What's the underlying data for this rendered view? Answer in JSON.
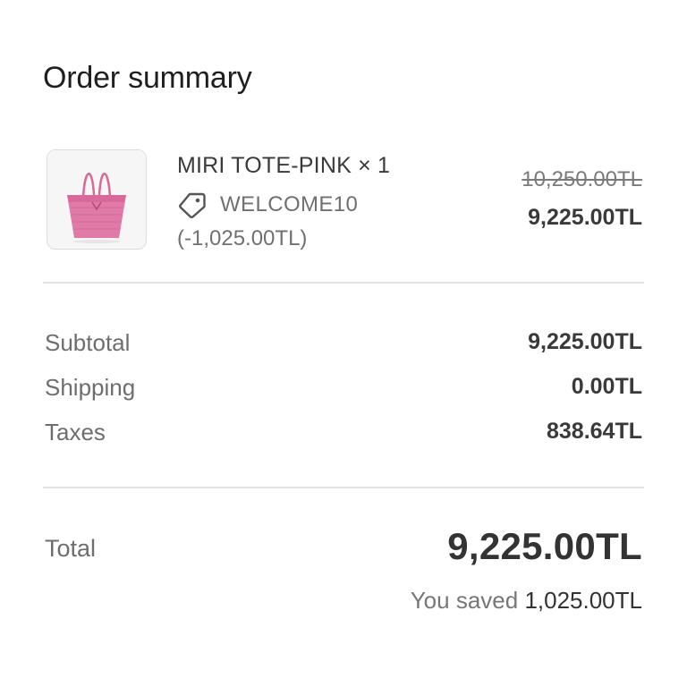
{
  "summary": {
    "title": "Order summary"
  },
  "product": {
    "image_icon": "pink-tote-bag",
    "name": "MIRI TOTE-PINK × 1",
    "discount_icon": "tag-icon",
    "discount_code": "WELCOME10",
    "discount_amount": "(-1,025.00TL)",
    "original_price": "10,250.00TL",
    "price": "9,225.00TL"
  },
  "costs": [
    {
      "label": "Subtotal",
      "value": "9,225.00TL"
    },
    {
      "label": "Shipping",
      "value": "0.00TL"
    },
    {
      "label": "Taxes",
      "value": "838.64TL"
    }
  ],
  "total": {
    "label": "Total",
    "value": "9,225.00TL",
    "saved_prefix": "You saved",
    "saved_amount": "1,025.00TL"
  },
  "colors": {
    "bag": "#e07aa6",
    "divider": "#e4e4e4",
    "text_dark": "#333333",
    "text_muted": "#707070"
  }
}
